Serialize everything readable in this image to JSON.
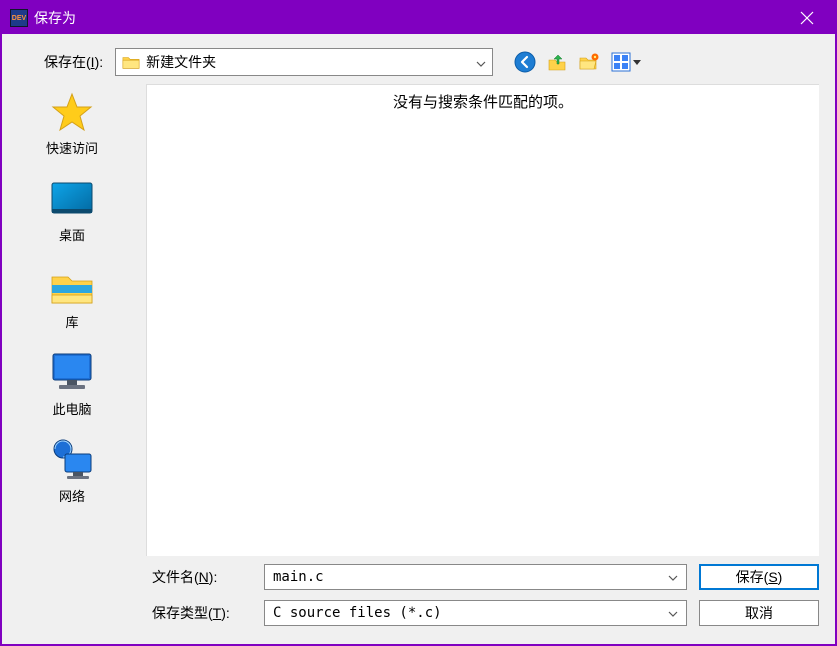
{
  "window": {
    "title": "保存为",
    "app_icon_text": "DEV"
  },
  "toprow": {
    "label_pre": "保存在(",
    "label_u": "I",
    "label_post": "):",
    "selected_dir": "新建文件夹"
  },
  "toolbar_icons": {
    "back": "back-icon",
    "up": "up-icon",
    "newfolder": "new-folder-icon",
    "viewmenu": "view-menu-icon"
  },
  "sidebar": {
    "items": [
      {
        "key": "quick",
        "label": "快速访问"
      },
      {
        "key": "desktop",
        "label": "桌面"
      },
      {
        "key": "library",
        "label": "库"
      },
      {
        "key": "pc",
        "label": "此电脑"
      },
      {
        "key": "network",
        "label": "网络"
      }
    ]
  },
  "file_area": {
    "empty_message": "没有与搜索条件匹配的项。"
  },
  "bottom": {
    "filename_label_pre": "文件名(",
    "filename_label_u": "N",
    "filename_label_post": "):",
    "filename_value": "main.c",
    "filetype_label_pre": "保存类型(",
    "filetype_label_u": "T",
    "filetype_label_post": "):",
    "filetype_value": "C source files (*.c)",
    "save_label_pre": "保存(",
    "save_label_u": "S",
    "save_label_post": ")",
    "cancel_label": "取消"
  }
}
